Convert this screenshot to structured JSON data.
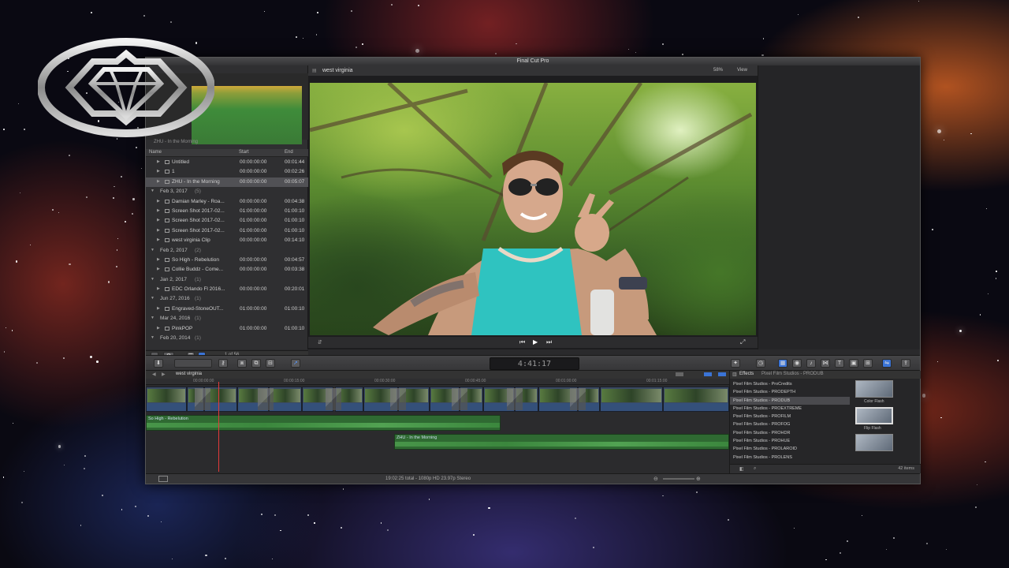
{
  "app": {
    "title": "Final Cut Pro"
  },
  "browser": {
    "clip_label": "ZHU - In the Morning",
    "columns": {
      "name": "Name",
      "start": "Start",
      "end": "End"
    },
    "rows": [
      {
        "type": "item",
        "name": "Untitled",
        "start": "00:00:00:00",
        "end": "00:01:44",
        "icon": "compound-clip-icon"
      },
      {
        "type": "item",
        "name": "1",
        "start": "00:00:00:00",
        "end": "00:02:26",
        "icon": "audio-clip-icon"
      },
      {
        "type": "item",
        "name": "ZHU - In the Morning",
        "start": "00:00:00:00",
        "end": "00:05:07",
        "icon": "audio-clip-icon",
        "selected": true
      },
      {
        "type": "group",
        "name": "Feb 3, 2017",
        "count": "(5)"
      },
      {
        "type": "item",
        "name": "Damian Marley - Roa...",
        "start": "00:00:00:00",
        "end": "00:04:38",
        "icon": "audio-clip-icon"
      },
      {
        "type": "item",
        "name": "Screen Shot 2017-02...",
        "start": "01:00:00:00",
        "end": "01:00:10",
        "icon": "image-clip-icon"
      },
      {
        "type": "item",
        "name": "Screen Shot 2017-02...",
        "start": "01:00:00:00",
        "end": "01:00:10",
        "icon": "image-clip-icon"
      },
      {
        "type": "item",
        "name": "Screen Shot 2017-02...",
        "start": "01:00:00:00",
        "end": "01:00:10",
        "icon": "image-clip-icon"
      },
      {
        "type": "item",
        "name": "west virginia Clip",
        "start": "00:00:00:00",
        "end": "00:14:10",
        "icon": "video-clip-icon"
      },
      {
        "type": "group",
        "name": "Feb 2, 2017",
        "count": "(2)"
      },
      {
        "type": "item",
        "name": "So High - Rebelution",
        "start": "00:00:00:00",
        "end": "00:04:57",
        "icon": "audio-clip-icon"
      },
      {
        "type": "item",
        "name": "Collie Buddz - Come...",
        "start": "00:00:00:00",
        "end": "00:03:38",
        "icon": "audio-clip-icon"
      },
      {
        "type": "group",
        "name": "Jan 2, 2017",
        "count": "(1)"
      },
      {
        "type": "item",
        "name": "EDC Orlando Fl 2016...",
        "start": "00:00:00:00",
        "end": "00:20:01",
        "icon": "video-clip-icon"
      },
      {
        "type": "group",
        "name": "Jun 27, 2016",
        "count": "(1)"
      },
      {
        "type": "item",
        "name": "Engraved-StoneOUT...",
        "start": "01:00:00:00",
        "end": "01:00:10",
        "icon": "image-clip-icon"
      },
      {
        "type": "group",
        "name": "Mar 24, 2016",
        "count": "(1)"
      },
      {
        "type": "item",
        "name": "PinkPOP",
        "start": "01:00:00:00",
        "end": "01:00:10",
        "icon": "image-clip-icon"
      },
      {
        "type": "group",
        "name": "Feb 20, 2014",
        "count": "(1)"
      }
    ],
    "footer_count": "1 of 56"
  },
  "viewer": {
    "title": "west virginia",
    "zoom": "58%",
    "view_label": "View"
  },
  "toolbar": {
    "timecode": "4:41:17"
  },
  "timeline": {
    "title": "west virginia",
    "ruler": [
      "00:00:00:00",
      "00:00:15:00",
      "00:00:30:00",
      "00:00:45:00",
      "00:01:00:00",
      "00:01:15:00"
    ],
    "audio_clips": [
      {
        "name": "So High - Rebelution"
      },
      {
        "name": "ZHU - In the Morning"
      }
    ]
  },
  "effects": {
    "title": "Effects",
    "category": "Pixel Film Studios - PRODUB",
    "items": [
      "Pixel Film Studios - ProCredits",
      "Pixel Film Studios - PRODEPTH",
      "Pixel Film Studios - PRODUB",
      "Pixel Film Studios - PROEXTREME",
      "Pixel Film Studios - PROFILM",
      "Pixel Film Studios - PROFOG",
      "Pixel Film Studios - PROHDR",
      "Pixel Film Studios - PROHUE",
      "Pixel Film Studios - PROLAROID",
      "Pixel Film Studios - PROLENS"
    ],
    "selected_index": 2,
    "thumbnails": [
      "Color Flash",
      "Flip Flash",
      ""
    ],
    "count": "42 items"
  },
  "status": {
    "info": "19:02:25 total - 1080p HD 23.97p Stereo"
  }
}
